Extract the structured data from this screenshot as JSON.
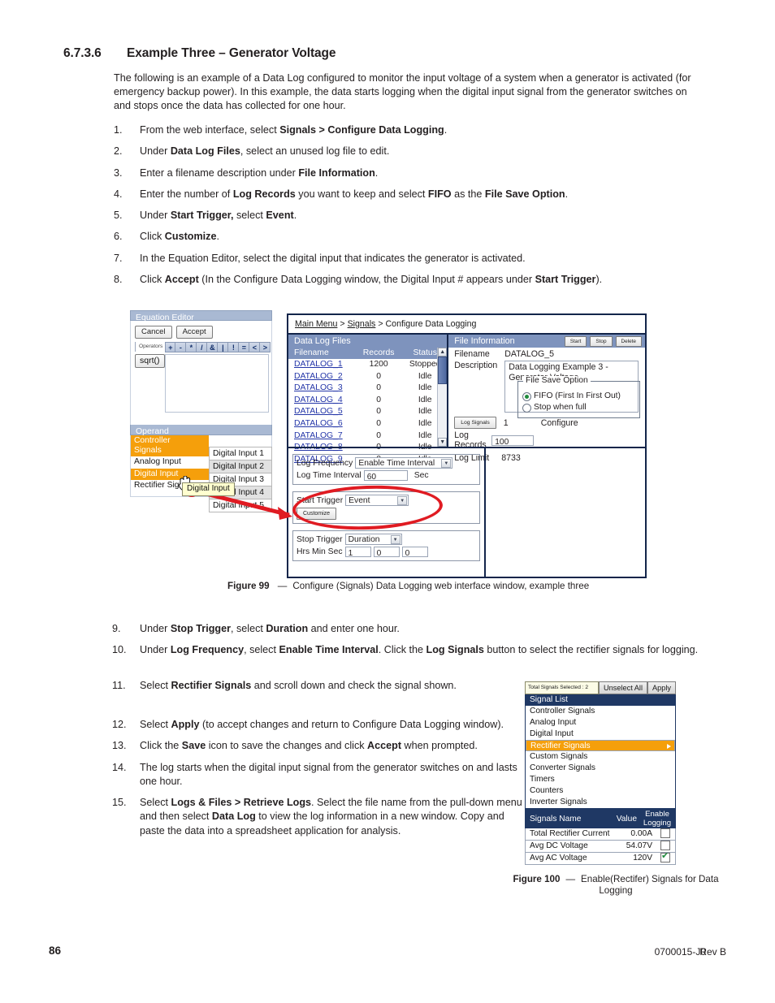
{
  "heading": {
    "number": "6.7.3.6",
    "title": "Example Three – Generator Voltage"
  },
  "intro": "The following is an example of a Data Log configured to monitor the input voltage of a system when a generator is activated (for emergency backup power). In this example, the data starts logging when the digital input signal from the generator switches on and stops once the data has collected for one hour.",
  "steps_a": [
    {
      "n": "1.",
      "html": "From the web interface, select <b>Signals > Configure Data Logging</b>."
    },
    {
      "n": "2.",
      "html": "Under <b>Data Log Files</b>, select an unused log file to edit."
    },
    {
      "n": "3.",
      "html": "Enter a filename description under <b>File Information</b>."
    },
    {
      "n": "4.",
      "html": "Enter the number of <b>Log Records</b> you want to keep and select <b>FIFO</b> as the <b>File Save Option</b>."
    },
    {
      "n": "5.",
      "html": "Under <b>Start Trigger,</b> select <b>Event</b>."
    },
    {
      "n": "6.",
      "html": "Click <b>Customize</b>."
    },
    {
      "n": "7.",
      "html": "In the Equation Editor, select the digital input that indicates the generator is activated."
    },
    {
      "n": "8.",
      "html": "Click <b>Accept</b> (In the Configure Data Logging window, the Digital Input # appears under <b>Start Trigger</b>)."
    }
  ],
  "steps_b": [
    {
      "n": "9.",
      "html": "Under <b>Stop Trigger</b>, select <b>Duration</b> and enter one hour."
    },
    {
      "n": "10.",
      "html": "Under <b>Log Frequency</b>, select <b>Enable Time Interval</b>. Click the <b>Log Signals</b> button to select the rectifier signals for logging."
    }
  ],
  "steps_b2": [
    {
      "n": "11.",
      "html": "Select <b>Rectifier Signals</b> and scroll down and check the signal shown."
    }
  ],
  "steps_c": [
    {
      "n": "12.",
      "html": "Select <b>Apply</b> (to accept changes and return to Configure Data Logging window)."
    },
    {
      "n": "13.",
      "html": "Click the <b>Save</b> icon to save the changes and click <b>Accept</b> when prompted."
    },
    {
      "n": "14.",
      "html": "The log starts when the digital input signal from the generator switches on and lasts one hour."
    },
    {
      "n": "15.",
      "html": "Select <b>Logs &amp; Files > Retrieve Logs</b>. Select the file name from the pull-down menu and then select <b>Data Log</b> to view the log information in a new window. Copy and paste the data into a spreadsheet application for analysis."
    }
  ],
  "equation_editor": {
    "title": "Equation Editor",
    "cancel": "Cancel",
    "accept": "Accept",
    "operators_label": "Operators",
    "operators": [
      "+",
      "-",
      "*",
      "/",
      "&",
      "|",
      "!",
      "=",
      "<",
      ">"
    ],
    "sqrt": "sqrt()",
    "operand_title": "Operand",
    "operand_items": [
      "Controller Signals",
      "Analog Input",
      "Digital Input",
      "Rectifier Signals"
    ],
    "operand_selected": "Digital Input",
    "digital_inputs": [
      "Digital Input 1",
      "Digital Input 2",
      "Digital Input 3",
      "Digital Input 4",
      "Digital Input 5"
    ],
    "tooltip": "Digital Input"
  },
  "configure_data_logging": {
    "breadcrumb": {
      "main_menu": "Main Menu",
      "signals": "Signals",
      "current": "Configure Data Logging",
      "sep": ">"
    },
    "data_log_files": {
      "panel_title": "Data Log Files",
      "columns": [
        "Filename",
        "Records",
        "Status"
      ],
      "rows": [
        {
          "filename": "DATALOG_1",
          "records": "1200",
          "status": "Stopped"
        },
        {
          "filename": "DATALOG_2",
          "records": "0",
          "status": "Idle"
        },
        {
          "filename": "DATALOG_3",
          "records": "0",
          "status": "Idle"
        },
        {
          "filename": "DATALOG_4",
          "records": "0",
          "status": "Idle"
        },
        {
          "filename": "DATALOG_5",
          "records": "0",
          "status": "Idle"
        },
        {
          "filename": "DATALOG_6",
          "records": "0",
          "status": "Idle"
        },
        {
          "filename": "DATALOG_7",
          "records": "0",
          "status": "Idle"
        },
        {
          "filename": "DATALOG_8",
          "records": "0",
          "status": "Idle"
        },
        {
          "filename": "DATALOG_9",
          "records": "0",
          "status": "Idle"
        }
      ]
    },
    "file_information": {
      "panel_title": "File Information",
      "buttons": [
        "Start",
        "Stop",
        "Delete"
      ],
      "filename_label": "Filename",
      "filename_value": "DATALOG_5",
      "description_label": "Description",
      "description_value": "Data Logging Example 3 - Generator Voltage",
      "log_signals_button": "Log Signals",
      "log_signals_count": "1",
      "configure_label": "Configure",
      "log_records_label": "Log Records",
      "log_records_value": "100",
      "log_limit_label": "Log Limit",
      "log_limit_value": "8733",
      "file_save_option": {
        "legend": "File Save Option",
        "options": [
          "FIFO (First In First Out)",
          "Stop when full"
        ],
        "selected": "FIFO (First In First Out)"
      }
    },
    "triggers": {
      "log_frequency_label": "Log Frequency",
      "log_frequency_value": "Enable Time Interval",
      "log_time_interval_label": "Log Time Interval",
      "log_time_interval_value": "60",
      "log_time_interval_unit": "Sec",
      "start_trigger_label": "Start Trigger",
      "start_trigger_value": "Event",
      "customize_button": "Customize",
      "stop_trigger_label": "Stop Trigger",
      "stop_trigger_value": "Duration",
      "hms_label": "Hrs Min Sec",
      "hours": "1",
      "minutes": "0",
      "seconds": "0"
    }
  },
  "figure99": {
    "lead": "Figure 99",
    "dash": "—",
    "caption": "Configure (Signals) Data Logging web interface window, example three"
  },
  "signal_list": {
    "total_selected": "Total Signals Selected : 2",
    "unselect_all": "Unselect All",
    "apply": "Apply",
    "header": "Signal List",
    "items": [
      "Controller Signals",
      "Analog Input",
      "Digital Input",
      "Rectifier Signals",
      "Custom Signals",
      "Converter Signals",
      "Timers",
      "Counters",
      "Inverter Signals"
    ],
    "selected": "Rectifier Signals",
    "table_headers": {
      "name": "Signals Name",
      "value": "Value",
      "enable": "Enable Logging"
    },
    "rows": [
      {
        "name": "Total Rectifier Current",
        "value": "0.00A",
        "checked": false
      },
      {
        "name": "Avg DC Voltage",
        "value": "54.07V",
        "checked": false
      },
      {
        "name": "Avg AC Voltage",
        "value": "120V",
        "checked": true
      }
    ]
  },
  "figure100": {
    "lead": "Figure 100",
    "dash": "—",
    "caption": "Enable(Rectifer) Signals for Data Logging"
  },
  "footer": {
    "page": "86",
    "doc_id": "0700015-J0",
    "revision": "Rev B"
  },
  "colors": {
    "accent_orange": "#f59f0b",
    "panel_blue": "#7e93bd",
    "navy": "#1f3864",
    "window_border": "#13254a",
    "annotation_red": "#e01b22",
    "link_blue": "#2436a8"
  }
}
